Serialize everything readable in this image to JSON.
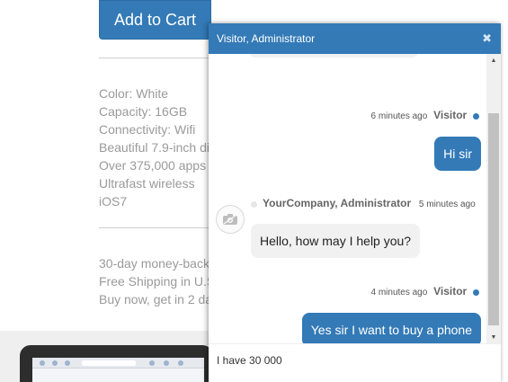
{
  "product": {
    "add_to_cart_label": "Add to Cart",
    "specs": [
      "Color: White",
      "Capacity: 16GB",
      "Connectivity: Wifi",
      "Beautiful 7.9-inch di",
      "Over 375,000 apps",
      "Ultrafast wireless",
      "iOS7"
    ],
    "perks": [
      "30-day money-back",
      "Free Shipping in U.S",
      "Buy now, get in 2 da"
    ]
  },
  "chat": {
    "title": "Visitor, Administrator",
    "close_icon": "close-icon",
    "messages": [
      {
        "sender": "Visitor",
        "time": "6 minutes ago",
        "text": "Hi sir",
        "direction": "outgoing"
      },
      {
        "sender": "YourCompany, Administrator",
        "time": "5 minutes ago",
        "text": "Hello, how may I help you?",
        "direction": "incoming",
        "avatar_icon": "camera-icon"
      },
      {
        "sender": "Visitor",
        "time": "4 minutes ago",
        "text": "Yes sir I want to buy a phone",
        "direction": "outgoing"
      }
    ],
    "input_value": "I have 30 000"
  },
  "colors": {
    "accent": "#337ab7",
    "bubble_incoming": "#f1f1f1",
    "muted_text": "#9a9a9a"
  }
}
